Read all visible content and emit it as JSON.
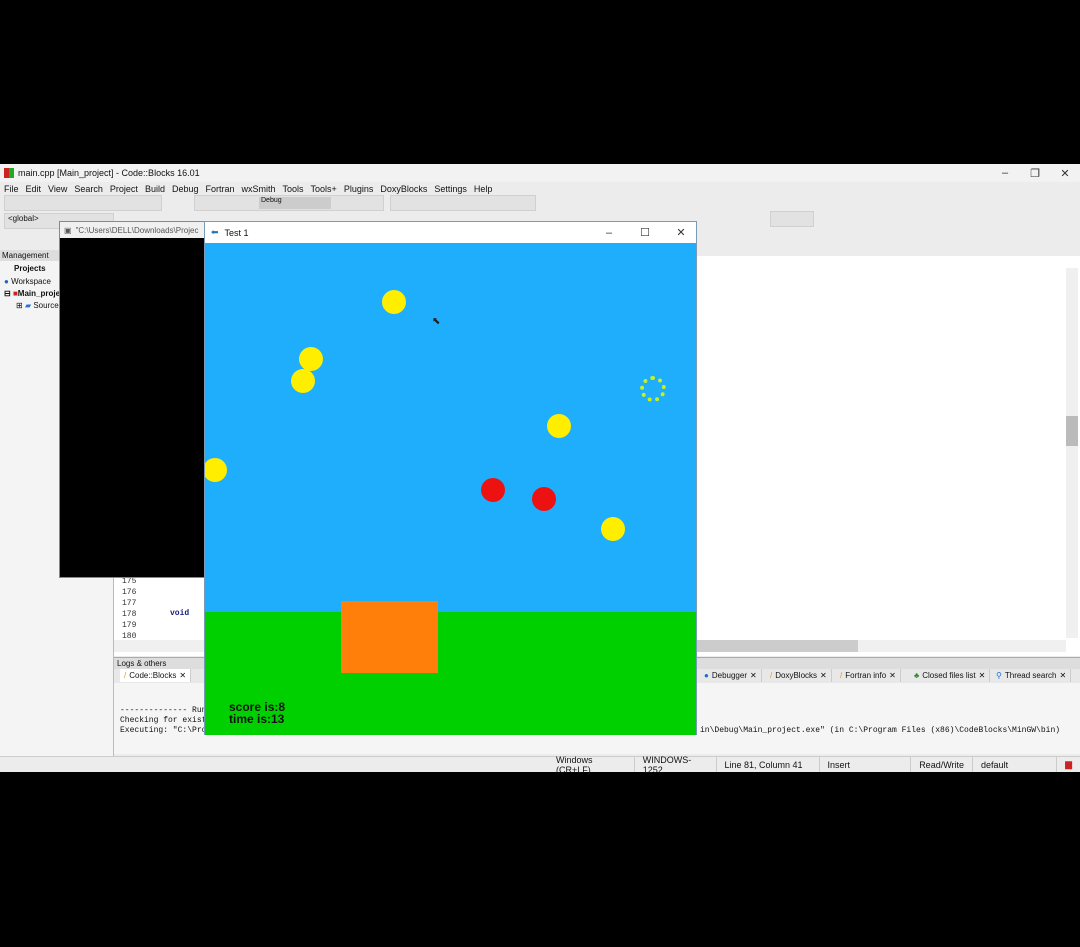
{
  "ide": {
    "title": "main.cpp [Main_project] - Code::Blocks 16.01",
    "menu": [
      "File",
      "Edit",
      "View",
      "Search",
      "Project",
      "Build",
      "Debug",
      "Fortran",
      "wxSmith",
      "Tools",
      "Tools+",
      "Plugins",
      "DoxyBlocks",
      "Settings",
      "Help"
    ],
    "build_target": "Debug",
    "scope": "<global>",
    "management": {
      "title": "Management",
      "tab": "Projects",
      "tree": [
        "Workspace",
        "Main_project",
        "Sources"
      ]
    },
    "editor": {
      "line_numbers": [
        "175",
        "176",
        "177",
        "178",
        "179",
        "180"
      ],
      "code_178": "void"
    },
    "logs": {
      "title": "Logs & others",
      "tabs": [
        "Code::Blocks",
        "Debugger",
        "DoxyBlocks",
        "Fortran info",
        "Closed files list",
        "Thread search"
      ],
      "lines": [
        "-------------- Run:",
        "Checking for existe",
        "Executing: \"C:\\Prog",
        "in\\Debug\\Main_project.exe\"  (in C:\\Program Files (x86)\\CodeBlocks\\MinGW\\bin)"
      ]
    },
    "status": [
      "Windows (CR+LF)",
      "WINDOWS-1252",
      "Line 81, Column 41",
      "Insert",
      "Read/Write",
      "default"
    ]
  },
  "console": {
    "title": "\"C:\\Users\\DELL\\Downloads\\Projec"
  },
  "game": {
    "title": "Test 1",
    "score_text": "score is:8",
    "time_text": "time is:13",
    "colors": {
      "sky": "#1eaefc",
      "ground": "#00d000",
      "player": "#ff7f0a",
      "yellow_ball": "#ffee00",
      "red_ball": "#ee1111"
    }
  }
}
